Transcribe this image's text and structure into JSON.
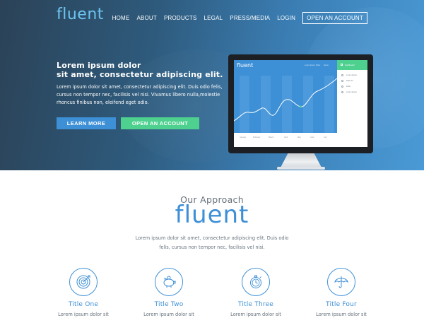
{
  "brand": {
    "logo": "fluent",
    "accent": "#3d8fd6",
    "green": "#4ed08f"
  },
  "nav": {
    "items": [
      "HOME",
      "ABOUT",
      "PRODUCTS",
      "LEGAL",
      "PRESS/MEDIA",
      "LOGIN"
    ],
    "cta": "OPEN AN ACCOUNT"
  },
  "hero": {
    "title_line1": "Lorem ipsum dolor",
    "title_line2": "sit amet, consectetur adipiscing elit.",
    "body": "Lorem ipsum dolor sit amet, consectetur adipiscing elit. Duis odio felis, cursus non tempor nec, facilisis vel nisi. Vivamus libero nulla,molestie rhoncus finibus non, eleifend eget odio.",
    "learn_more": "LEARN MORE",
    "open_account": "OPEN AN ACCOUNT"
  },
  "screen": {
    "logo": "fluent",
    "menu": [
      "Lorem ipsum",
      "Dolor",
      "Ipsum"
    ],
    "side_header": "Dashboard",
    "side_items": [
      "Lorem ipsum",
      "Dolor sit",
      "Dolor",
      "Lorem ipsum"
    ],
    "months": [
      "January",
      "February",
      "March",
      "April",
      "May",
      "June",
      "July"
    ]
  },
  "approach": {
    "subtitle": "Our Approach",
    "title": "fluent",
    "text_line1": "Lorem ipsum dolor sit amet, consectetur adipiscing elit. Duis odio",
    "text_line2": "felis, cursus non tempor nec, facilisis vel nisi."
  },
  "features": [
    {
      "icon": "target-icon",
      "title": "Title One",
      "text": "Lorem ipsum dolor sit"
    },
    {
      "icon": "piggy-bank-icon",
      "title": "Title Two",
      "text": "Lorem ipsum dolor sit"
    },
    {
      "icon": "stopwatch-icon",
      "title": "Title Three",
      "text": "Lorem ipsum dolor sit"
    },
    {
      "icon": "umbrella-icon",
      "title": "Title Four",
      "text": "Lorem ipsum dolor sit"
    }
  ]
}
